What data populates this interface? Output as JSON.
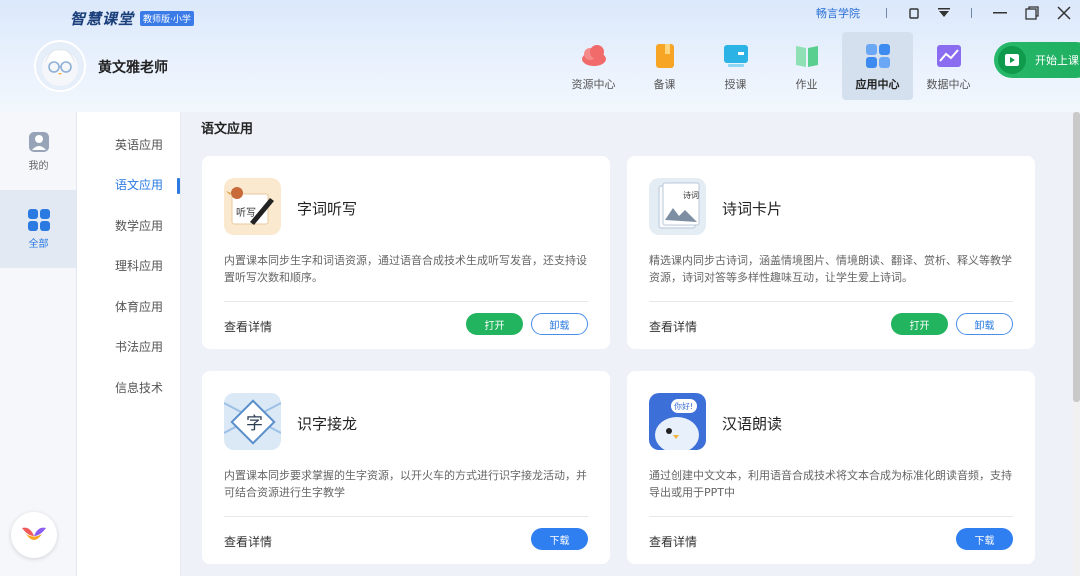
{
  "app": {
    "logo_text": "智慧课堂",
    "badge": "教师版·小学"
  },
  "topbar": {
    "link": "畅言学院"
  },
  "user": {
    "name": "黄文雅老师"
  },
  "nav": [
    {
      "label": "资源中心",
      "color": "#f26b6b"
    },
    {
      "label": "备课",
      "color": "#f7a525"
    },
    {
      "label": "授课",
      "color": "#2bb3e6"
    },
    {
      "label": "作业",
      "color": "#58cf8f"
    },
    {
      "label": "应用中心",
      "color": "#3d8af0",
      "active": true
    },
    {
      "label": "数据中心",
      "color": "#8a6cf0"
    }
  ],
  "start_button": {
    "label": "开始上课"
  },
  "rail": {
    "mine": "我的",
    "all": "全部"
  },
  "categories": [
    "英语应用",
    "语文应用",
    "数学应用",
    "理科应用",
    "体育应用",
    "书法应用",
    "信息技术"
  ],
  "section_title": "语文应用",
  "cards": [
    {
      "title": "字词听写",
      "desc": "内置课本同步生字和词语资源，通过语音合成技术生成听写发音，还支持设置听写次数和顺序。",
      "detail": "查看详情",
      "open": "打开",
      "uninstall": "卸载"
    },
    {
      "title": "诗词卡片",
      "desc": "精选课内同步古诗词，涵盖情境图片、情境朗读、翻译、赏析、释义等教学资源，诗词对答等多样性趣味互动，让学生爱上诗词。",
      "detail": "查看详情",
      "open": "打开",
      "uninstall": "卸载"
    },
    {
      "title": "识字接龙",
      "desc": "内置课本同步要求掌握的生字资源，以开火车的方式进行识字接龙活动，并可结合资源进行生字教学",
      "detail": "查看详情",
      "download": "下载"
    },
    {
      "title": "汉语朗读",
      "desc": "通过创建中文文本，利用语音合成技术将文本合成为标准化朗读音频，支持导出或用于PPT中",
      "detail": "查看详情",
      "download": "下载"
    }
  ],
  "icon_text": {
    "dictation": "听写",
    "poem": "诗词",
    "char": "字",
    "hello": "你好!"
  }
}
